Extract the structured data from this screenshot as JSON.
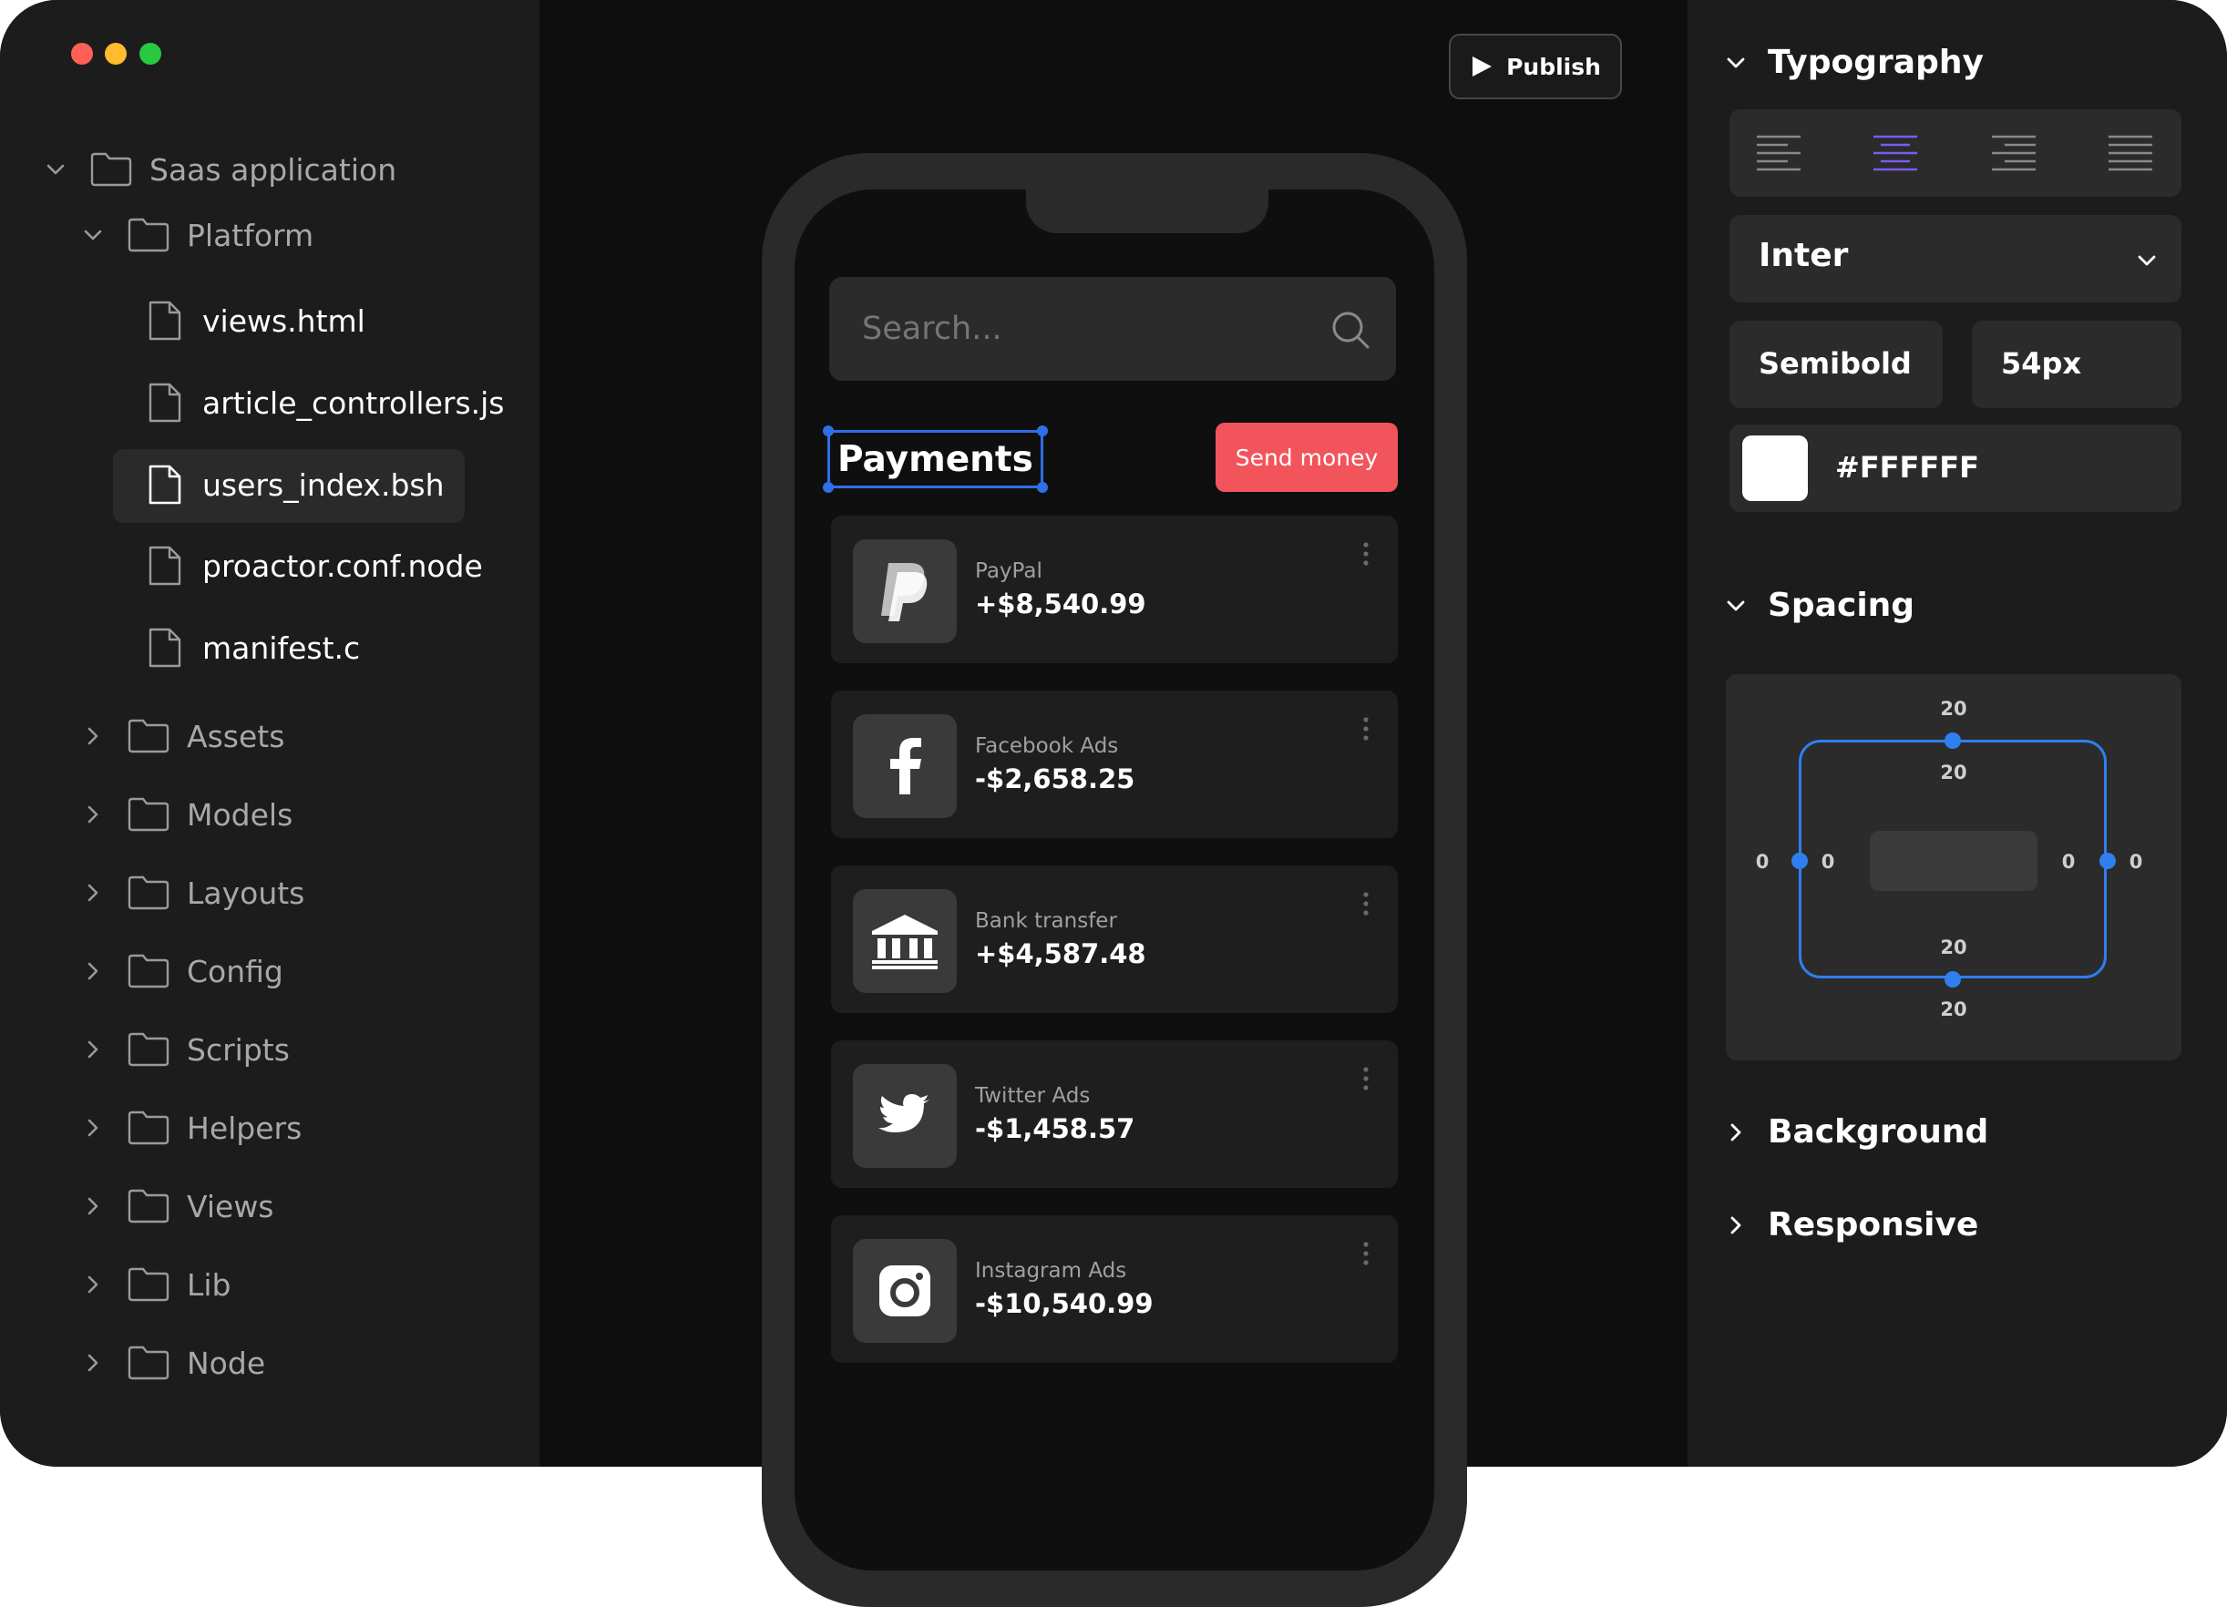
{
  "window_controls": {
    "close_color": "#ff5f57",
    "minimize_color": "#febc2e",
    "zoom_color": "#28c840"
  },
  "file_tree": {
    "root": {
      "label": "Saas application",
      "icon": "folder-icon"
    },
    "platform": {
      "label": "Platform",
      "icon": "folder-icon"
    },
    "files": [
      {
        "label": "views.html"
      },
      {
        "label": "article_controllers.js"
      },
      {
        "label": "users_index.bsh",
        "selected": true
      },
      {
        "label": "proactor.conf.node"
      },
      {
        "label": "manifest.c"
      }
    ],
    "folders": [
      {
        "label": "Assets"
      },
      {
        "label": "Models"
      },
      {
        "label": "Layouts"
      },
      {
        "label": "Config"
      },
      {
        "label": "Scripts"
      },
      {
        "label": "Helpers"
      },
      {
        "label": "Views"
      },
      {
        "label": "Lib"
      },
      {
        "label": "Node"
      }
    ]
  },
  "toolbar": {
    "publish_label": "Publish"
  },
  "phone": {
    "search": {
      "placeholder": "Search..."
    },
    "section_title": "Payments",
    "send_money_label": "Send money",
    "send_money_color": "#f2545b",
    "transactions": [
      {
        "name": "PayPal",
        "amount": "+$8,540.99",
        "icon": "paypal-icon"
      },
      {
        "name": "Facebook Ads",
        "amount": "-$2,658.25",
        "icon": "facebook-icon"
      },
      {
        "name": "Bank transfer",
        "amount": "+$4,587.48",
        "icon": "bank-icon"
      },
      {
        "name": "Twitter Ads",
        "amount": "-$1,458.57",
        "icon": "twitter-icon"
      },
      {
        "name": "Instagram Ads",
        "amount": "-$10,540.99",
        "icon": "instagram-icon"
      }
    ]
  },
  "inspector": {
    "typography": {
      "title": "Typography",
      "alignment_selected": "center",
      "alignment_accent": "#7b5cf0",
      "font_family": "Inter",
      "font_weight": "Semibold",
      "font_size": "54px",
      "color_value": "#FFFFFF"
    },
    "spacing": {
      "title": "Spacing",
      "margin_top": "20",
      "padding_top": "20",
      "margin_left": "0",
      "padding_left": "0",
      "padding_right": "0",
      "margin_right": "0",
      "padding_bottom": "20",
      "margin_bottom": "20"
    },
    "background": {
      "title": "Background"
    },
    "responsive": {
      "title": "Responsive"
    }
  }
}
